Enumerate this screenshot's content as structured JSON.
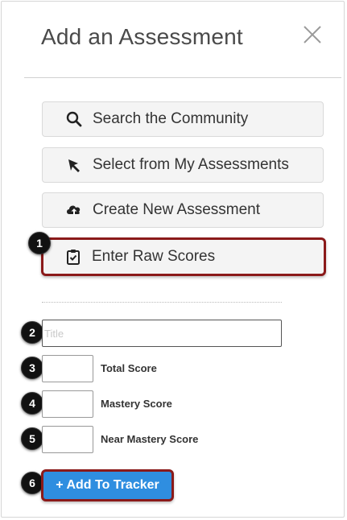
{
  "dialog": {
    "title": "Add an Assessment"
  },
  "options": [
    {
      "label": "Search the Community",
      "icon": "search-icon"
    },
    {
      "label": "Select from My Assessments",
      "icon": "cursor-arrow-icon"
    },
    {
      "label": "Create New Assessment",
      "icon": "cloud-upload-icon"
    },
    {
      "label": "Enter Raw Scores",
      "icon": "clipboard-check-icon",
      "highlighted": true
    }
  ],
  "form": {
    "title_placeholder": "Title",
    "total_score_label": "Total Score",
    "mastery_score_label": "Mastery Score",
    "near_mastery_score_label": "Near Mastery Score",
    "add_button_label": "+ Add To Tracker"
  },
  "callouts": [
    "1",
    "2",
    "3",
    "4",
    "5",
    "6"
  ],
  "colors": {
    "highlight_border": "#8b1a1a",
    "primary_button": "#2f8ee0",
    "option_background": "#f4f4f4"
  }
}
